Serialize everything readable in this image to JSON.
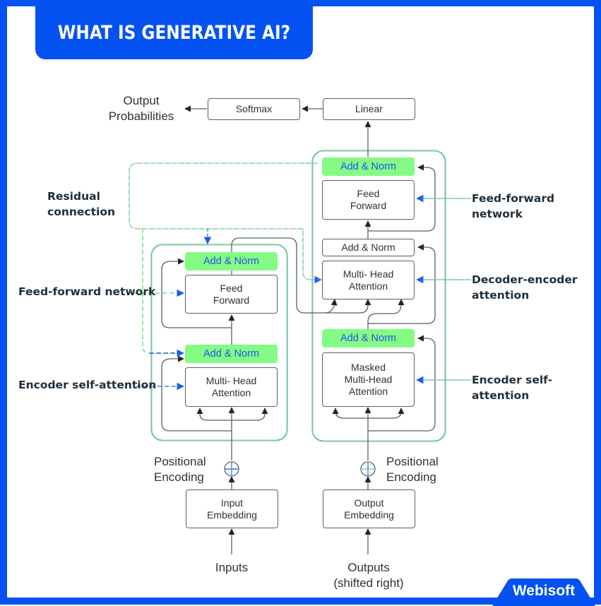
{
  "header": {
    "title": "WHAT IS GENERATIVE AI?"
  },
  "brand": {
    "name": "Webisoft"
  },
  "colors": {
    "brand_blue": "#0452f2",
    "norm_green": "#84fb84",
    "norm_text_blue": "#2a4ef5",
    "line_gray": "#55606b",
    "dashed_blue": "#1d5cf0",
    "dashed_green": "#6fe07a"
  },
  "diagram": {
    "top": {
      "output_probabilities": [
        "Output",
        "Probabilities"
      ],
      "softmax": "Softmax",
      "linear": "Linear"
    },
    "encoder": {
      "add_norm_top": "Add & Norm",
      "feed_forward": [
        "Feed",
        "Forward"
      ],
      "add_norm_bottom": "Add & Norm",
      "multi_head_attention": [
        "Multi- Head",
        "Attention"
      ],
      "positional_encoding": [
        "Positional",
        "Encoding"
      ],
      "input_embedding": [
        "Input",
        "Embedding"
      ],
      "inputs": "Inputs"
    },
    "decoder": {
      "add_norm_top": "Add & Norm",
      "feed_forward": [
        "Feed",
        "Forward"
      ],
      "add_norm_middle": "Add & Norm",
      "multi_head_attention": [
        "Multi- Head",
        "Attention"
      ],
      "add_norm_bottom": "Add & Norm",
      "masked_attention": [
        "Masked",
        "Multi-Head",
        "Attention"
      ],
      "positional_encoding": [
        "Positional",
        "Encoding"
      ],
      "output_embedding": [
        "Output",
        "Embedding"
      ],
      "outputs": [
        "Outputs",
        "(shifted right)"
      ]
    },
    "annotations": {
      "residual_connection": [
        "Residual",
        "connection"
      ],
      "left_feed_forward": "Feed-forward network",
      "left_encoder_self_attention": "Encoder self-attention",
      "right_feed_forward": [
        "Feed-forward",
        "network"
      ],
      "right_decoder_encoder": [
        "Decoder-encoder",
        "attention"
      ],
      "right_encoder_self_attention": [
        "Encoder self-",
        "attention"
      ]
    }
  }
}
